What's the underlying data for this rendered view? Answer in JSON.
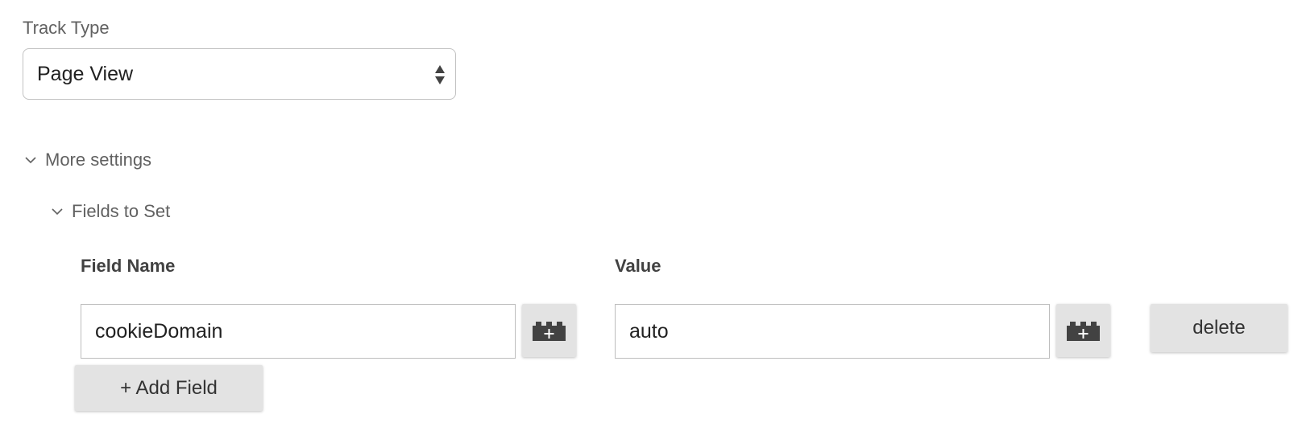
{
  "track_type": {
    "label": "Track Type",
    "selected": "Page View",
    "icon": "updown-arrows-icon"
  },
  "more_settings": {
    "label": "More settings",
    "expanded": true,
    "icon": "chevron-down-icon"
  },
  "fields_to_set": {
    "label": "Fields to Set",
    "expanded": true,
    "icon": "chevron-down-icon",
    "columns": {
      "name": "Field Name",
      "value": "Value"
    },
    "rows": [
      {
        "field_name": "cookieDomain",
        "value": "auto",
        "variable_icon": "variable-brick-icon",
        "delete_label": "delete"
      }
    ],
    "add_field_label": "+ Add Field"
  },
  "colors": {
    "button_bg": "#e3e3e3",
    "icon_dark": "#424242",
    "label_gray": "#616161"
  }
}
